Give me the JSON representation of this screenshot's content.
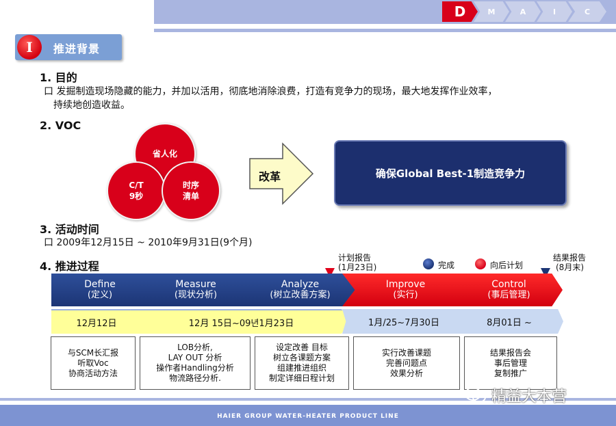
{
  "dmaic": {
    "steps": [
      "D",
      "M",
      "A",
      "I",
      "C"
    ],
    "active_color": "#d8001a",
    "inactive_color": "#c9d0ea"
  },
  "section": {
    "number": "I",
    "title": "推进背景"
  },
  "purpose": {
    "heading": "1. 目的",
    "line1": "口 发掘制造现场隐藏的能力，并加以活用，彻底地消除浪费，打造有竞争力的现场，最大地发挥作业效率，",
    "line2": "持续地创造收益。"
  },
  "voc": {
    "heading": "2.  VOC",
    "circles": {
      "top": "省人化",
      "left_line1": "C/T",
      "left_line2": "9秒",
      "right_line1": "时序",
      "right_line2": "清单"
    },
    "arrow_label": "改革",
    "goal": "确保Global Best-1制造竞争力"
  },
  "schedule": {
    "heading": "3. 活动时间",
    "period": "口 2009年12月15日 ~ 2010年9月31日(9个月)"
  },
  "process": {
    "heading": "4. 推进过程",
    "milestone_plan_line1": "计划报告",
    "milestone_plan_line2": "(1月23日)",
    "milestone_result_line1": "结果报告",
    "milestone_result_line2": "(8月末)",
    "legend_done": "完成",
    "legend_planned": "向后计划",
    "phases": [
      {
        "en": "Define",
        "cn": "(定义)"
      },
      {
        "en": "Measure",
        "cn": "(现状分析)"
      },
      {
        "en": "Analyze",
        "cn": "(树立改善方案)"
      },
      {
        "en": "Improve",
        "cn": "(实行)"
      },
      {
        "en": "Control",
        "cn": "(事后管理)"
      }
    ],
    "dates": [
      "12月12日",
      "12月 15日~09년1月23日",
      "1月/25~7月30日",
      "8月01日 ~"
    ],
    "activities": [
      [
        "与SCM长汇报",
        "听取Voc",
        "协商活动方法"
      ],
      [
        "LOB分析,",
        "LAY OUT 分析",
        "操作者Handling分析",
        "物流路径分析."
      ],
      [
        "设定改善 目标",
        "树立各课题方案",
        "组建推进组织",
        "制定详细日程计划"
      ],
      [
        "实行改善课题",
        "完善问题点",
        "效果分析"
      ],
      [
        "结果报告会",
        "事后管理",
        "复制推广"
      ]
    ],
    "colors": {
      "done": "#1c3575",
      "planned": "#d8001a"
    }
  },
  "footer": {
    "text": "HAIER GROUP WATER-HEATER PRODUCT LINE"
  },
  "watermark": {
    "text": "精益大本营"
  }
}
